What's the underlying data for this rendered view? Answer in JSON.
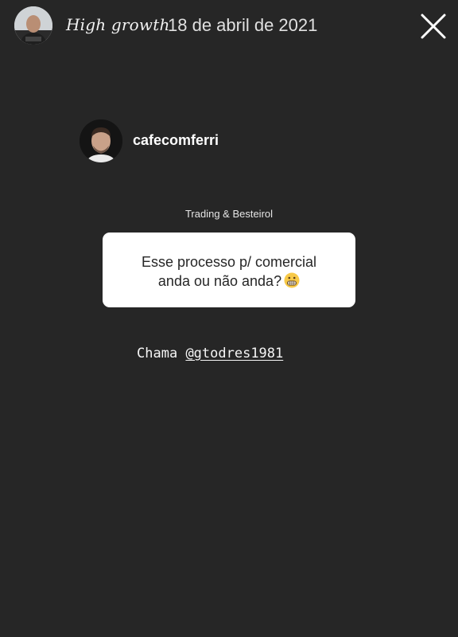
{
  "header": {
    "story_title": "High growth",
    "date": "18 de abril de 2021",
    "avatar_icon": "profile-avatar",
    "close_icon": "close-icon"
  },
  "responder": {
    "username": "cafecomferri",
    "avatar_icon": "profile-avatar"
  },
  "question": {
    "sticker_title": "Trading & Besteirol",
    "text_line1": "Esse processo p/ comercial",
    "text_line2": "anda ou não anda?",
    "emoji": "grimacing-face-emoji"
  },
  "answer": {
    "prefix": "Chama",
    "mention": "@gtodres1981"
  },
  "colors": {
    "background": "#262626",
    "card": "#ffffff",
    "text": "#ffffff"
  }
}
